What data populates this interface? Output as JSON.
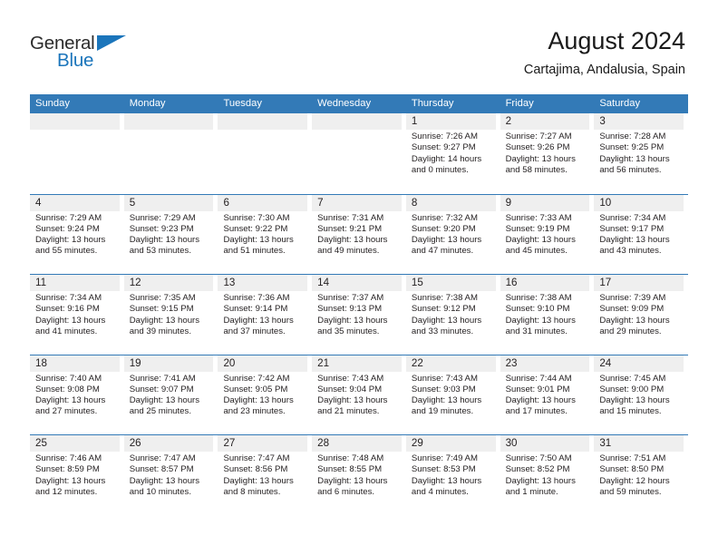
{
  "logo": {
    "word1": "General",
    "word2": "Blue",
    "triangle_color": "#1b75bb",
    "word1_color": "#2c2c2c",
    "word2_color": "#1b75bb"
  },
  "header": {
    "title": "August 2024",
    "subtitle": "Cartajima, Andalusia, Spain"
  },
  "theme": {
    "header_blue": "#337ab7",
    "daynum_gray": "#efefef",
    "text": "#231f20"
  },
  "calendar": {
    "weekday_headers": [
      "Sunday",
      "Monday",
      "Tuesday",
      "Wednesday",
      "Thursday",
      "Friday",
      "Saturday"
    ],
    "weeks": [
      [
        {
          "day": "",
          "empty": true
        },
        {
          "day": "",
          "empty": true
        },
        {
          "day": "",
          "empty": true
        },
        {
          "day": "",
          "empty": true
        },
        {
          "day": "1",
          "sunrise": "Sunrise: 7:26 AM",
          "sunset": "Sunset: 9:27 PM",
          "daylight1": "Daylight: 14 hours",
          "daylight2": "and 0 minutes."
        },
        {
          "day": "2",
          "sunrise": "Sunrise: 7:27 AM",
          "sunset": "Sunset: 9:26 PM",
          "daylight1": "Daylight: 13 hours",
          "daylight2": "and 58 minutes."
        },
        {
          "day": "3",
          "sunrise": "Sunrise: 7:28 AM",
          "sunset": "Sunset: 9:25 PM",
          "daylight1": "Daylight: 13 hours",
          "daylight2": "and 56 minutes."
        }
      ],
      [
        {
          "day": "4",
          "sunrise": "Sunrise: 7:29 AM",
          "sunset": "Sunset: 9:24 PM",
          "daylight1": "Daylight: 13 hours",
          "daylight2": "and 55 minutes."
        },
        {
          "day": "5",
          "sunrise": "Sunrise: 7:29 AM",
          "sunset": "Sunset: 9:23 PM",
          "daylight1": "Daylight: 13 hours",
          "daylight2": "and 53 minutes."
        },
        {
          "day": "6",
          "sunrise": "Sunrise: 7:30 AM",
          "sunset": "Sunset: 9:22 PM",
          "daylight1": "Daylight: 13 hours",
          "daylight2": "and 51 minutes."
        },
        {
          "day": "7",
          "sunrise": "Sunrise: 7:31 AM",
          "sunset": "Sunset: 9:21 PM",
          "daylight1": "Daylight: 13 hours",
          "daylight2": "and 49 minutes."
        },
        {
          "day": "8",
          "sunrise": "Sunrise: 7:32 AM",
          "sunset": "Sunset: 9:20 PM",
          "daylight1": "Daylight: 13 hours",
          "daylight2": "and 47 minutes."
        },
        {
          "day": "9",
          "sunrise": "Sunrise: 7:33 AM",
          "sunset": "Sunset: 9:19 PM",
          "daylight1": "Daylight: 13 hours",
          "daylight2": "and 45 minutes."
        },
        {
          "day": "10",
          "sunrise": "Sunrise: 7:34 AM",
          "sunset": "Sunset: 9:17 PM",
          "daylight1": "Daylight: 13 hours",
          "daylight2": "and 43 minutes."
        }
      ],
      [
        {
          "day": "11",
          "sunrise": "Sunrise: 7:34 AM",
          "sunset": "Sunset: 9:16 PM",
          "daylight1": "Daylight: 13 hours",
          "daylight2": "and 41 minutes."
        },
        {
          "day": "12",
          "sunrise": "Sunrise: 7:35 AM",
          "sunset": "Sunset: 9:15 PM",
          "daylight1": "Daylight: 13 hours",
          "daylight2": "and 39 minutes."
        },
        {
          "day": "13",
          "sunrise": "Sunrise: 7:36 AM",
          "sunset": "Sunset: 9:14 PM",
          "daylight1": "Daylight: 13 hours",
          "daylight2": "and 37 minutes."
        },
        {
          "day": "14",
          "sunrise": "Sunrise: 7:37 AM",
          "sunset": "Sunset: 9:13 PM",
          "daylight1": "Daylight: 13 hours",
          "daylight2": "and 35 minutes."
        },
        {
          "day": "15",
          "sunrise": "Sunrise: 7:38 AM",
          "sunset": "Sunset: 9:12 PM",
          "daylight1": "Daylight: 13 hours",
          "daylight2": "and 33 minutes."
        },
        {
          "day": "16",
          "sunrise": "Sunrise: 7:38 AM",
          "sunset": "Sunset: 9:10 PM",
          "daylight1": "Daylight: 13 hours",
          "daylight2": "and 31 minutes."
        },
        {
          "day": "17",
          "sunrise": "Sunrise: 7:39 AM",
          "sunset": "Sunset: 9:09 PM",
          "daylight1": "Daylight: 13 hours",
          "daylight2": "and 29 minutes."
        }
      ],
      [
        {
          "day": "18",
          "sunrise": "Sunrise: 7:40 AM",
          "sunset": "Sunset: 9:08 PM",
          "daylight1": "Daylight: 13 hours",
          "daylight2": "and 27 minutes."
        },
        {
          "day": "19",
          "sunrise": "Sunrise: 7:41 AM",
          "sunset": "Sunset: 9:07 PM",
          "daylight1": "Daylight: 13 hours",
          "daylight2": "and 25 minutes."
        },
        {
          "day": "20",
          "sunrise": "Sunrise: 7:42 AM",
          "sunset": "Sunset: 9:05 PM",
          "daylight1": "Daylight: 13 hours",
          "daylight2": "and 23 minutes."
        },
        {
          "day": "21",
          "sunrise": "Sunrise: 7:43 AM",
          "sunset": "Sunset: 9:04 PM",
          "daylight1": "Daylight: 13 hours",
          "daylight2": "and 21 minutes."
        },
        {
          "day": "22",
          "sunrise": "Sunrise: 7:43 AM",
          "sunset": "Sunset: 9:03 PM",
          "daylight1": "Daylight: 13 hours",
          "daylight2": "and 19 minutes."
        },
        {
          "day": "23",
          "sunrise": "Sunrise: 7:44 AM",
          "sunset": "Sunset: 9:01 PM",
          "daylight1": "Daylight: 13 hours",
          "daylight2": "and 17 minutes."
        },
        {
          "day": "24",
          "sunrise": "Sunrise: 7:45 AM",
          "sunset": "Sunset: 9:00 PM",
          "daylight1": "Daylight: 13 hours",
          "daylight2": "and 15 minutes."
        }
      ],
      [
        {
          "day": "25",
          "sunrise": "Sunrise: 7:46 AM",
          "sunset": "Sunset: 8:59 PM",
          "daylight1": "Daylight: 13 hours",
          "daylight2": "and 12 minutes."
        },
        {
          "day": "26",
          "sunrise": "Sunrise: 7:47 AM",
          "sunset": "Sunset: 8:57 PM",
          "daylight1": "Daylight: 13 hours",
          "daylight2": "and 10 minutes."
        },
        {
          "day": "27",
          "sunrise": "Sunrise: 7:47 AM",
          "sunset": "Sunset: 8:56 PM",
          "daylight1": "Daylight: 13 hours",
          "daylight2": "and 8 minutes."
        },
        {
          "day": "28",
          "sunrise": "Sunrise: 7:48 AM",
          "sunset": "Sunset: 8:55 PM",
          "daylight1": "Daylight: 13 hours",
          "daylight2": "and 6 minutes."
        },
        {
          "day": "29",
          "sunrise": "Sunrise: 7:49 AM",
          "sunset": "Sunset: 8:53 PM",
          "daylight1": "Daylight: 13 hours",
          "daylight2": "and 4 minutes."
        },
        {
          "day": "30",
          "sunrise": "Sunrise: 7:50 AM",
          "sunset": "Sunset: 8:52 PM",
          "daylight1": "Daylight: 13 hours",
          "daylight2": "and 1 minute."
        },
        {
          "day": "31",
          "sunrise": "Sunrise: 7:51 AM",
          "sunset": "Sunset: 8:50 PM",
          "daylight1": "Daylight: 12 hours",
          "daylight2": "and 59 minutes."
        }
      ]
    ]
  }
}
